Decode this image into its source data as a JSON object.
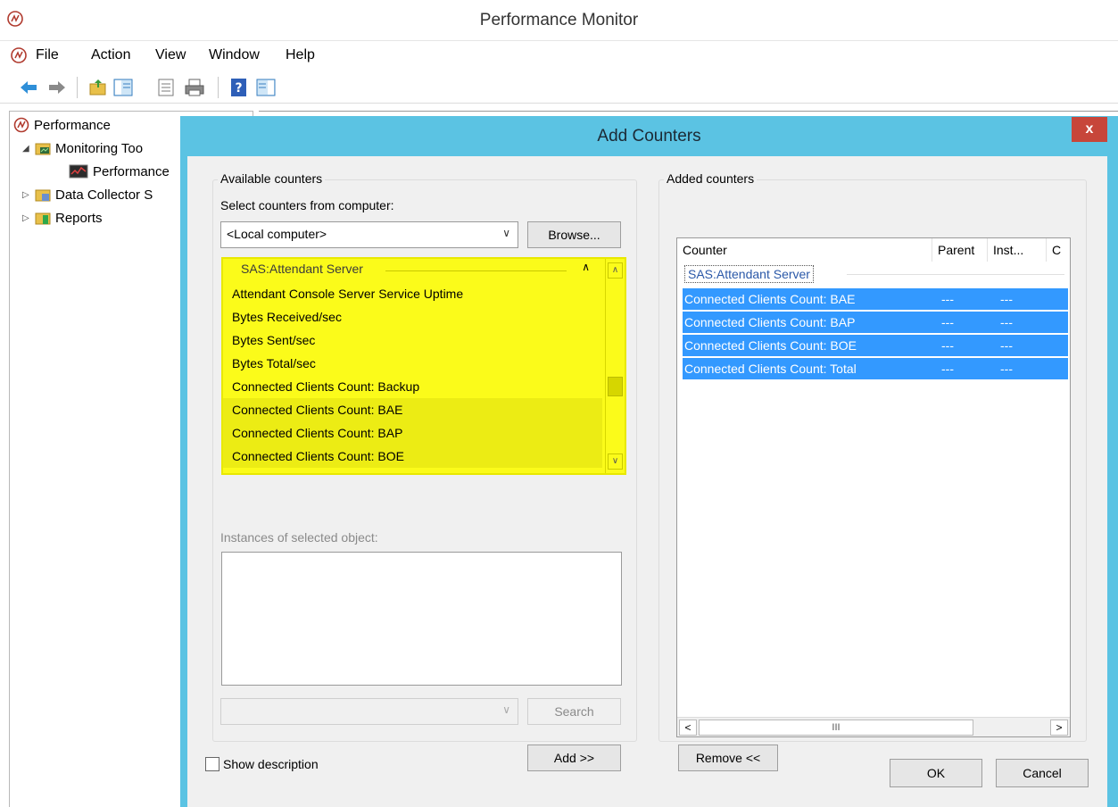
{
  "window": {
    "title": "Performance Monitor"
  },
  "menu": {
    "items": [
      "File",
      "Action",
      "View",
      "Window",
      "Help"
    ]
  },
  "toolbar": {
    "icons": [
      "back-icon",
      "forward-icon",
      "up-folder-icon",
      "show-hide-tree-icon",
      "properties-icon",
      "print-icon",
      "help-icon",
      "show-hide-action-pane-icon"
    ]
  },
  "tree": {
    "root": "Performance",
    "items": [
      "Monitoring Too",
      "Performance",
      "Data Collector S",
      "Reports"
    ]
  },
  "dialog": {
    "title": "Add Counters",
    "close_label": "x",
    "available": {
      "group_label": "Available counters",
      "select_label": "Select counters from computer:",
      "computer": "<Local computer>",
      "browse_label": "Browse...",
      "object_header": "SAS:Attendant Server",
      "counters": [
        "Attendant Console Server Service Uptime",
        "Bytes Received/sec",
        "Bytes Sent/sec",
        "Bytes Total/sec",
        "Connected Clients Count: Backup",
        "Connected Clients Count: BAE",
        "Connected Clients Count: BAP",
        "Connected Clients Count: BOE"
      ],
      "instances_label": "Instances of selected object:",
      "search_label": "Search",
      "add_label": "Add >>"
    },
    "added": {
      "group_label": "Added counters",
      "columns": [
        "Counter",
        "Parent",
        "Inst...",
        "C"
      ],
      "object": "SAS:Attendant Server",
      "rows": [
        {
          "counter": "Connected Clients Count: BAE",
          "parent": "---",
          "instance": "---"
        },
        {
          "counter": "Connected Clients Count: BAP",
          "parent": "---",
          "instance": "---"
        },
        {
          "counter": "Connected Clients Count: BOE",
          "parent": "---",
          "instance": "---"
        },
        {
          "counter": "Connected Clients Count: Total",
          "parent": "---",
          "instance": "---"
        }
      ],
      "scroll_grip": "III",
      "remove_label": "Remove <<"
    },
    "show_description_label": "Show description",
    "ok_label": "OK",
    "cancel_label": "Cancel"
  },
  "colors": {
    "dialog_frame": "#5bc3e3",
    "close_button": "#c7463a",
    "highlight": "#fbfb1a",
    "selection": "#3399ff"
  }
}
